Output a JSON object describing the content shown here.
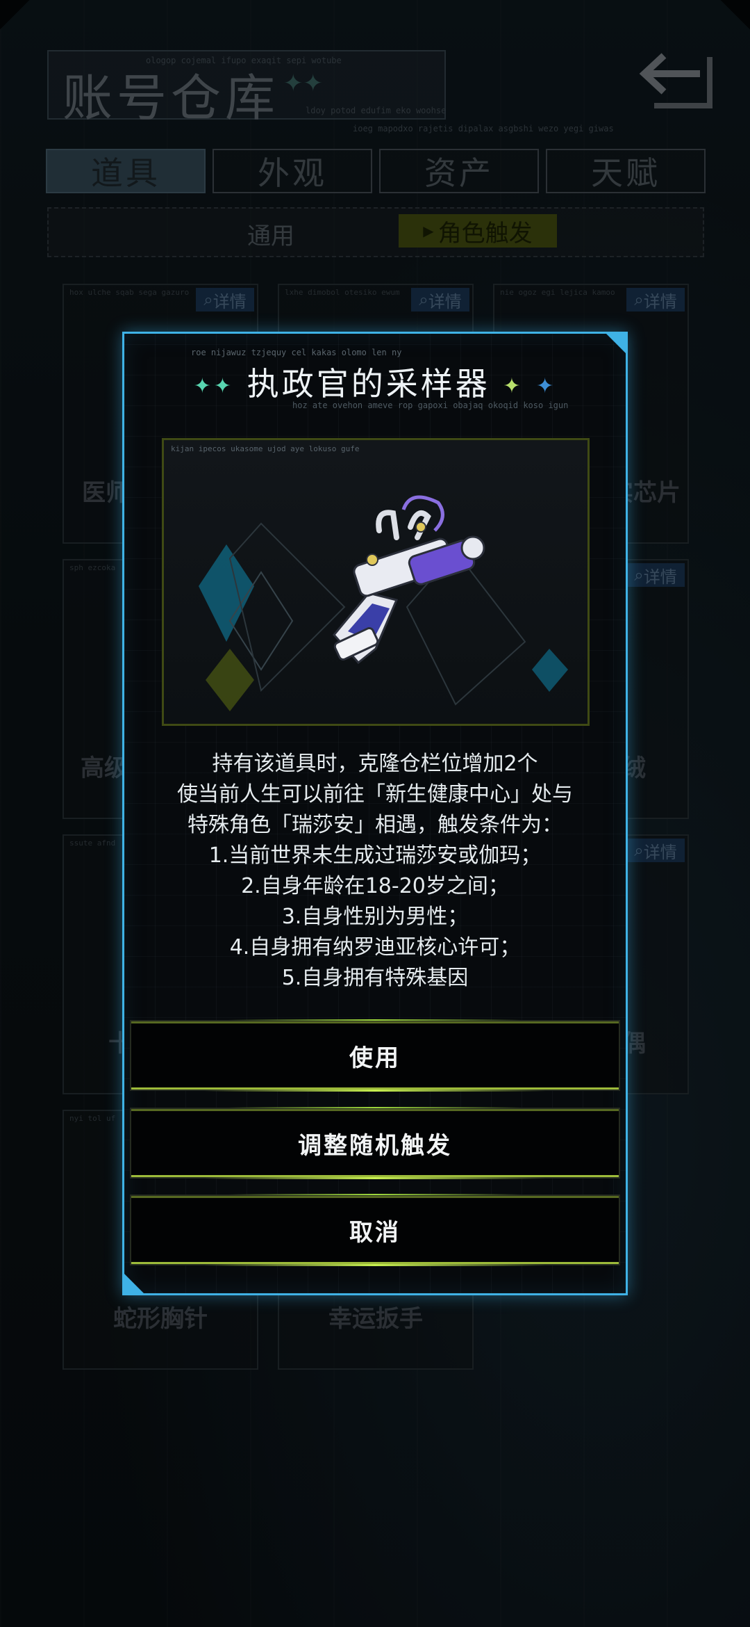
{
  "header": {
    "title": "账号仓库",
    "title_stars": "✦✦",
    "micro_texts": [
      "ologop cojemal ifupo exaqit sepi wotube",
      "ldoy potod edufim eko woohse",
      "ioeg mapodxo rajetis dipalax asgbshi wezo yegi giwas"
    ]
  },
  "tabs": [
    {
      "label": "道具",
      "active": true
    },
    {
      "label": "外观",
      "active": false
    },
    {
      "label": "资产",
      "active": false
    },
    {
      "label": "天赋",
      "active": false
    }
  ],
  "subtabs": {
    "general": "通用",
    "trigger": "角色触发"
  },
  "cards": [
    {
      "name": "医师的",
      "code": "hox ulche sqab sega gazuro",
      "detail": "详情"
    },
    {
      "name": "",
      "code": "lxhe dimobol otesiko ewum",
      "detail": "详情"
    },
    {
      "name": "反抗军纪实芯片",
      "code": "nie ogoz egi lejica kamoo",
      "detail": "详情"
    },
    {
      "name": "高级节目组",
      "code": "sph ezcoka",
      "detail": ""
    },
    {
      "name": "",
      "code": "",
      "detail": ""
    },
    {
      "name": "心光绒",
      "code": "",
      "detail": "详情"
    },
    {
      "name": "十",
      "code": "ssute afnd",
      "detail": ""
    },
    {
      "name": "",
      "code": "",
      "detail": ""
    },
    {
      "name": "应援布偶",
      "code": "",
      "detail": "详情"
    },
    {
      "name": "蛇形胸针",
      "code": "nyi tol uf",
      "detail": ""
    },
    {
      "name": "幸运扳手",
      "code": "",
      "detail": ""
    }
  ],
  "modal": {
    "title": "执政官的采样器",
    "title_glyph_left": "✦✦",
    "title_glyph_right": "✦",
    "title_glyph_right2": "✦",
    "micro_top": "roe nijawuz tzjequy cel kakas olomo len ny",
    "micro_bottom": "hoz ate ovehon ameve rop gapoxi obajaq okoqid koso igun",
    "art_code": "kijan ipecos ukasome ujod aye lokuso gufe",
    "description_lines": [
      "持有该道具时，克隆仓栏位增加2个",
      "使当前人生可以前往「新生健康中心」处与",
      "特殊角色「瑞莎安」相遇，触发条件为：",
      "1.当前世界未生成过瑞莎安或伽玛；",
      "2.自身年龄在18-20岁之间；",
      "3.自身性别为男性；",
      "4.自身拥有纳罗迪亚核心许可；",
      "5.自身拥有特殊基因"
    ],
    "buttons": {
      "use": "使用",
      "adjust": "调整随机触发",
      "cancel": "取消"
    }
  },
  "colors": {
    "modal_border": "#3fb2e6",
    "button_glow": "#9dbb3a",
    "item_purple": "#6a4fd0"
  },
  "icons": {
    "back": "back-arrow-icon",
    "detail": "magnifier-icon"
  }
}
